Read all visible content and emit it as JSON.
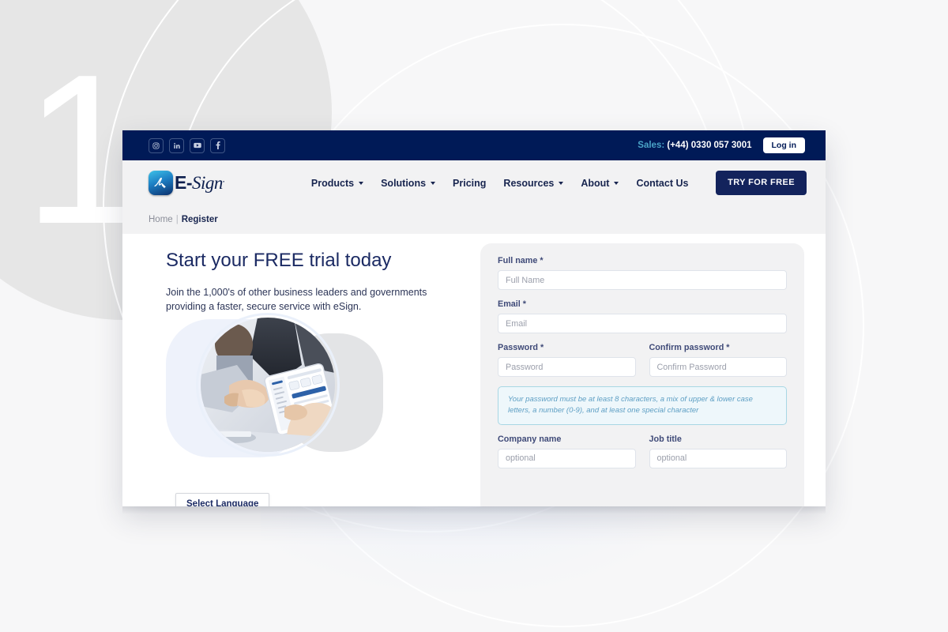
{
  "background": {
    "numeral": "1"
  },
  "top_bar": {
    "social_icons": [
      {
        "name": "instagram-icon",
        "label": "Instagram"
      },
      {
        "name": "linkedin-icon",
        "label": "LinkedIn"
      },
      {
        "name": "youtube-icon",
        "label": "YouTube"
      },
      {
        "name": "facebook-icon",
        "label": "Facebook"
      }
    ],
    "sales_label": "Sales:",
    "sales_phone": "(+44) 0330 057 3001",
    "login_label": "Log in"
  },
  "header": {
    "logo_text_main": "E-",
    "logo_text_script": "Sign",
    "logo_trademark": ".",
    "nav_items": [
      {
        "label": "Products",
        "has_dropdown": true
      },
      {
        "label": "Solutions",
        "has_dropdown": true
      },
      {
        "label": "Pricing",
        "has_dropdown": false
      },
      {
        "label": "Resources",
        "has_dropdown": true
      },
      {
        "label": "About",
        "has_dropdown": true
      },
      {
        "label": "Contact Us",
        "has_dropdown": false
      }
    ],
    "cta_label": "TRY FOR FREE"
  },
  "breadcrumb": {
    "home": "Home",
    "separator": "|",
    "current": "Register"
  },
  "hero": {
    "title": "Start your FREE trial today",
    "subtitle": "Join the 1,000's of other business leaders and governments providing a faster, secure service with eSign."
  },
  "language_widget": {
    "label": "Select Language"
  },
  "form": {
    "full_name": {
      "label": "Full name *",
      "placeholder": "Full Name",
      "value": ""
    },
    "email": {
      "label": "Email *",
      "placeholder": "Email",
      "value": ""
    },
    "password": {
      "label": "Password *",
      "placeholder": "Password",
      "value": ""
    },
    "confirm_password": {
      "label": "Confirm password *",
      "placeholder": "Confirm Password",
      "value": ""
    },
    "password_hint": "Your password must be at least 8 characters, a mix of upper & lower case letters, a number (0-9), and at least one special character",
    "company_name": {
      "label": "Company name",
      "placeholder": "optional",
      "value": ""
    },
    "job_title": {
      "label": "Job title",
      "placeholder": "optional",
      "value": ""
    }
  },
  "colors": {
    "navy": "#001a57",
    "brand_navy": "#13235c",
    "accent_cyan": "#4aa3c7",
    "hint_border": "#a8d7e4",
    "hint_text": "#5e9fc4",
    "panel_grey": "#f2f2f3",
    "page_bg": "#f7f7f8"
  }
}
